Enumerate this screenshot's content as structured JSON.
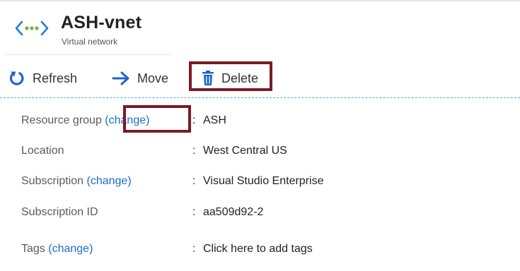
{
  "header": {
    "title": "ASH-vnet",
    "subtitle": "Virtual network"
  },
  "toolbar": {
    "refresh_label": "Refresh",
    "move_label": "Move",
    "delete_label": "Delete"
  },
  "properties": {
    "resource_group": {
      "key": "Resource group ",
      "change": "(change)",
      "colon": ":",
      "value": "ASH"
    },
    "location": {
      "key": "Location",
      "colon": ":",
      "value": "West Central US"
    },
    "subscription": {
      "key": "Subscription ",
      "change": "(change)",
      "colon": ":",
      "value": "Visual Studio Enterprise"
    },
    "subscription_id": {
      "key": "Subscription ID",
      "colon": ":",
      "value": "aa509d92-2"
    },
    "tags": {
      "key": "Tags ",
      "change": "(change)",
      "colon": ":",
      "value": "Click here to add tags"
    }
  },
  "icons": {
    "vnet": "vnet-icon",
    "refresh": "refresh-icon",
    "move": "arrow-right-icon",
    "delete": "trash-icon"
  },
  "colors": {
    "link": "#1a6fc9",
    "highlight_border": "#7b1a24",
    "icon_blue": "#1e64c8",
    "vnet_green": "#6cb33e",
    "separator": "#5aa8dc"
  }
}
